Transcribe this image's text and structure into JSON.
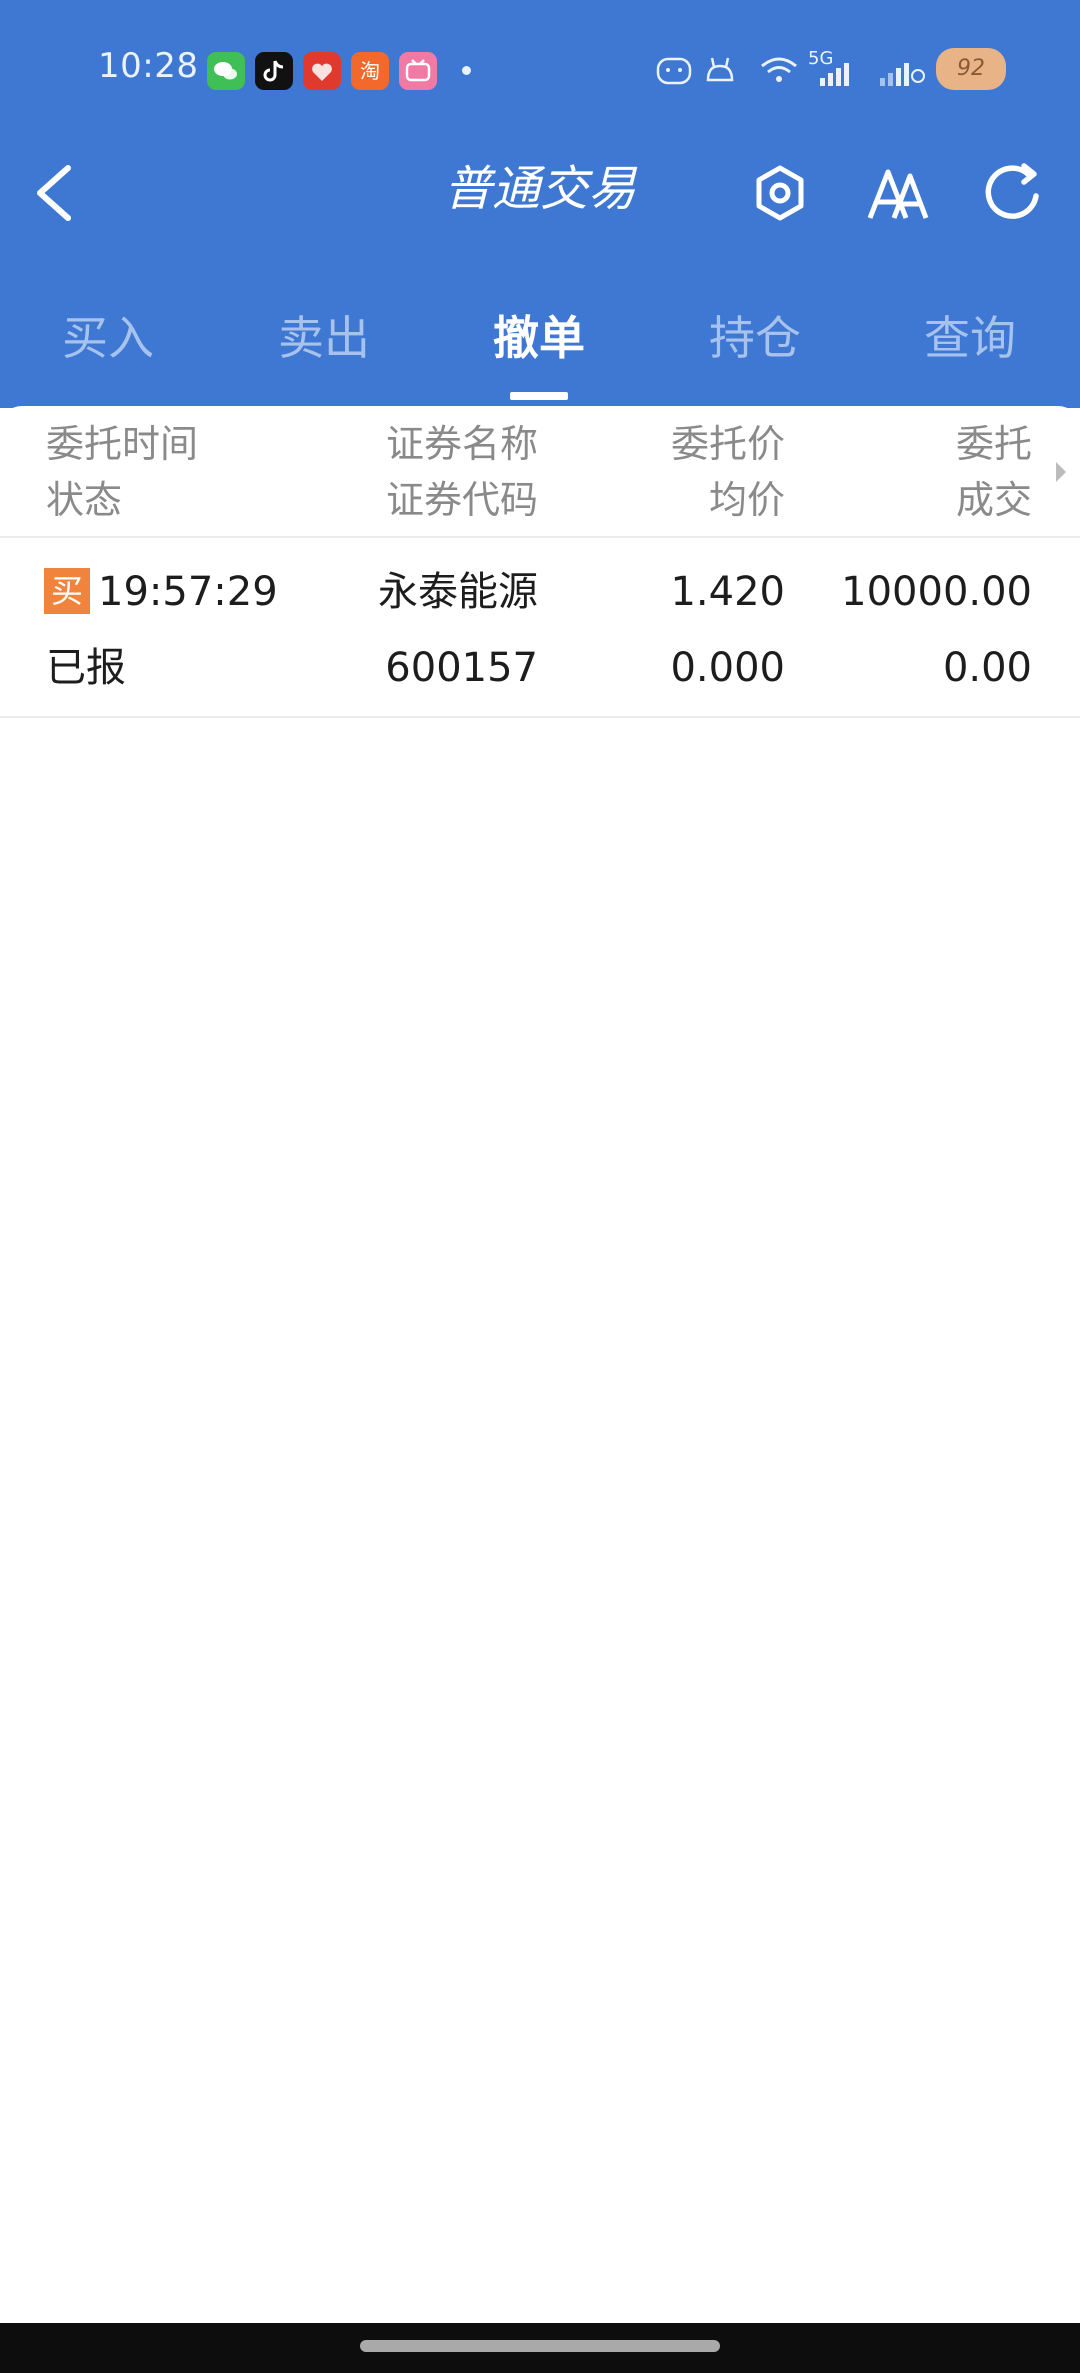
{
  "status_bar": {
    "time": "10:28",
    "apps": [
      "wechat",
      "tiktok",
      "xiaohongshu",
      "taobao",
      "bilibili"
    ],
    "taobao_char": "淘",
    "network": "5G",
    "battery": "92"
  },
  "header": {
    "title": "普通交易"
  },
  "tabs": [
    {
      "label": "买入"
    },
    {
      "label": "卖出"
    },
    {
      "label": "撤单"
    },
    {
      "label": "持仓"
    },
    {
      "label": "查询"
    }
  ],
  "active_tab": "撤单",
  "table": {
    "headers": {
      "col1": {
        "top": "委托时间",
        "bottom": "状态"
      },
      "col2": {
        "top": "证券名称",
        "bottom": "证券代码"
      },
      "col3": {
        "top": "委托价",
        "bottom": "均价"
      },
      "col4": {
        "top": "委托",
        "bottom": "成交"
      }
    },
    "rows": [
      {
        "side": "买",
        "time": "19:57:29",
        "status": "已报",
        "name": "永泰能源",
        "code": "600157",
        "price": "1.420",
        "avg_price": "0.000",
        "order_qty": "10000.00",
        "filled_qty": "0.00"
      }
    ]
  },
  "colors": {
    "primary": "#3f78d2",
    "buy_badge": "#f0843c"
  }
}
